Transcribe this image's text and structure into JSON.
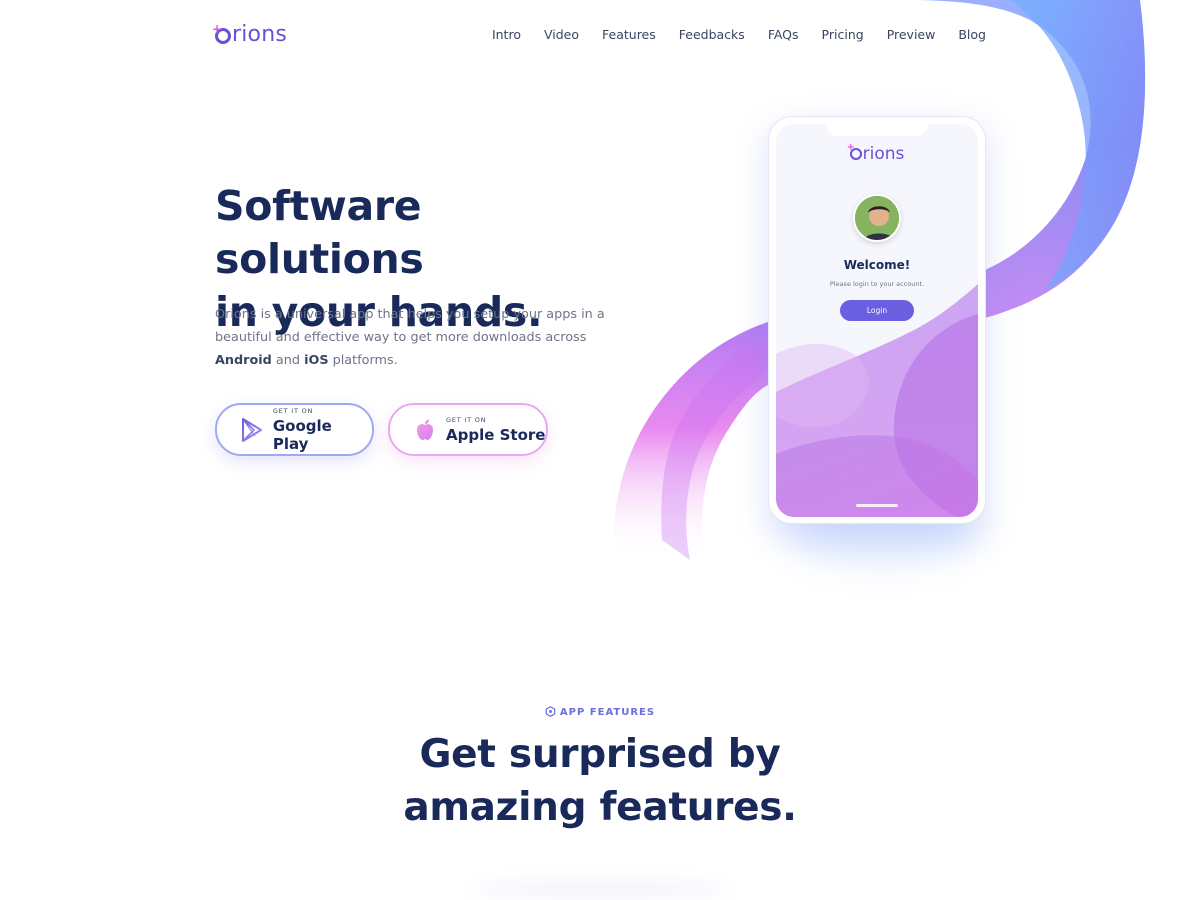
{
  "brand": {
    "name": "rions",
    "logo_prefix": "O"
  },
  "nav": {
    "items": [
      {
        "label": "Intro"
      },
      {
        "label": "Video"
      },
      {
        "label": "Features"
      },
      {
        "label": "Feedbacks"
      },
      {
        "label": "FAQs"
      },
      {
        "label": "Pricing"
      },
      {
        "label": "Preview"
      },
      {
        "label": "Blog"
      }
    ]
  },
  "hero": {
    "title_line1": "Software solutions",
    "title_line2": "in your hands.",
    "desc_part1": "Orions is a universal app that helps you setup your apps in a beautiful and effective way to get more downloads across",
    "desc_android": "Android",
    "desc_and": "and",
    "desc_ios": "iOS",
    "desc_part2": "platforms."
  },
  "store_buttons": {
    "google": {
      "small": "GET IT ON",
      "big": "Google Play",
      "icon": "google-play-icon"
    },
    "apple": {
      "small": "GET IT ON",
      "big": "Apple Store",
      "icon": "apple-icon"
    }
  },
  "phone": {
    "logo_prefix": "O",
    "logo_name": "rions",
    "welcome": "Welcome!",
    "subtitle": "Please login to your account.",
    "login_label": "Login"
  },
  "features_section": {
    "kicker": "APP FEATURES",
    "title_line1": "Get surprised by",
    "title_line2": "amazing features."
  },
  "colors": {
    "brand_purple": "#6a4fd8",
    "navy_text": "#18295a",
    "accent_pink": "#e05ad6",
    "accent_blue": "#7aa8ff",
    "login_button": "#6a5fe0"
  }
}
